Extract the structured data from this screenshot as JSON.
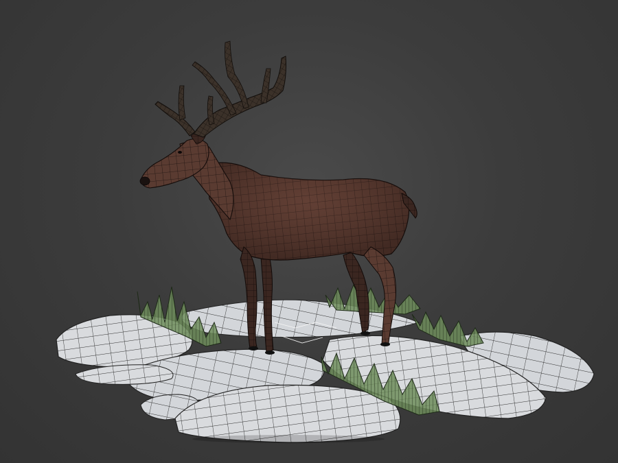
{
  "scene": {
    "subject": "deer",
    "colors": {
      "background": "#3c3c3c",
      "rock": "#d8dadd",
      "rock_shade": "#b8bcc2",
      "wire": "#2a2a2a",
      "fur": "#5a3a30",
      "fur_dark": "#2e1e1a",
      "antler": "#3a3028",
      "grass": "#6e8c5a"
    }
  }
}
